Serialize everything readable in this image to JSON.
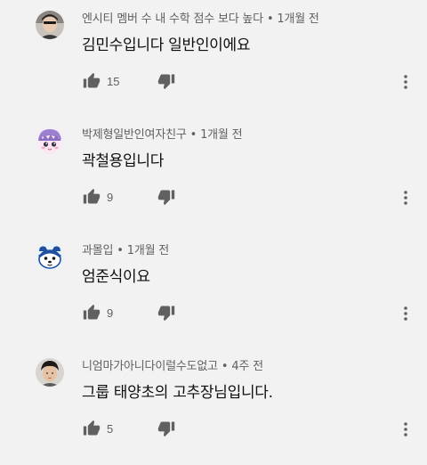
{
  "comments": [
    {
      "author": "엔시티 멤버 수 내 수학 점수 보다 높다",
      "time": "1개월 전",
      "text": "김민수입니다 일반인이에요",
      "likes": "15",
      "avatar_icon": "user-photo-avatar"
    },
    {
      "author": "박제형일반인여자친구",
      "time": "1개월 전",
      "text": "곽철용입니다",
      "likes": "9",
      "avatar_icon": "cartoon-face-avatar"
    },
    {
      "author": "과몰입",
      "time": "1개월 전",
      "text": "엄준식이요",
      "likes": "9",
      "avatar_icon": "cartoon-animal-avatar"
    },
    {
      "author": "니엄마가아니다이럴수도없고",
      "time": "4주 전",
      "text": "그룹 태양초의 고추장님입니다.",
      "likes": "5",
      "avatar_icon": "user-photo-avatar"
    }
  ],
  "separator": "•",
  "icons": {
    "like": "thumbs-up-icon",
    "dislike": "thumbs-down-icon",
    "more": "more-vertical-icon"
  },
  "colors": {
    "background": "#f2f2f2",
    "meta_text": "#606060",
    "icon": "#606060",
    "body_text": "#0f0f0f"
  }
}
